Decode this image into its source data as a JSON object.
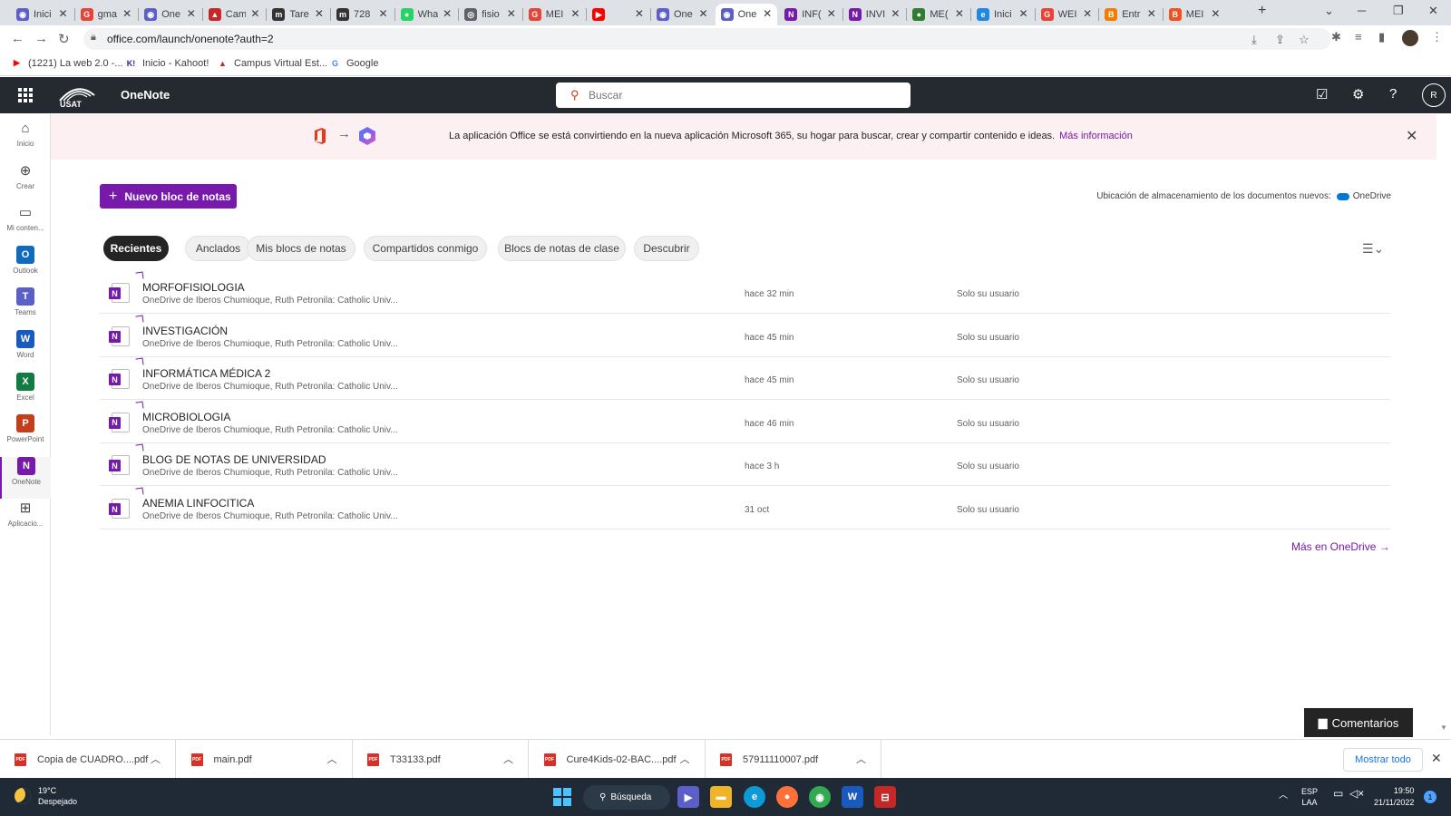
{
  "browser": {
    "tabs": [
      {
        "label": "Inici",
        "color": "#5b5fc7",
        "glyph": "◉"
      },
      {
        "label": "gma",
        "color": "#ea4335",
        "glyph": "G"
      },
      {
        "label": "One",
        "color": "#5b5fc7",
        "glyph": "◉"
      },
      {
        "label": "Cam",
        "color": "#c62828",
        "glyph": "▲"
      },
      {
        "label": "Tare",
        "color": "#333333",
        "glyph": "m"
      },
      {
        "label": "728",
        "color": "#333333",
        "glyph": "m"
      },
      {
        "label": "Wha",
        "color": "#25d366",
        "glyph": "●"
      },
      {
        "label": "fisio",
        "color": "#5f6368",
        "glyph": "◎"
      },
      {
        "label": "MEI",
        "color": "#ea4335",
        "glyph": "G"
      },
      {
        "label": "",
        "color": "#ff0000",
        "glyph": "▶"
      },
      {
        "label": "One",
        "color": "#5b5fc7",
        "glyph": "◉"
      },
      {
        "label": "One",
        "color": "#5b5fc7",
        "glyph": "◉"
      },
      {
        "label": "INF(",
        "color": "#7719aa",
        "glyph": "N"
      },
      {
        "label": "INVI",
        "color": "#7719aa",
        "glyph": "N"
      },
      {
        "label": "ME(",
        "color": "#2e7d32",
        "glyph": "●"
      },
      {
        "label": "Inici",
        "color": "#1e88e5",
        "glyph": "e"
      },
      {
        "label": "WEI",
        "color": "#ea4335",
        "glyph": "G"
      },
      {
        "label": "Entr",
        "color": "#f57c00",
        "glyph": "B"
      },
      {
        "label": "MEI",
        "color": "#f4511e",
        "glyph": "B"
      }
    ],
    "url": "office.com/launch/onenote?auth=2",
    "bookmarks": [
      {
        "label": "(1221) La web 2.0 -...",
        "color": "#ff0000",
        "glyph": "▶"
      },
      {
        "label": "Inicio - Kahoot!",
        "color": "#46178f",
        "glyph": "K!"
      },
      {
        "label": "Campus Virtual Est...",
        "color": "#c62828",
        "glyph": "▲"
      },
      {
        "label": "Google",
        "color": "#4285f4",
        "glyph": "G"
      }
    ]
  },
  "header": {
    "app_name": "OneNote",
    "search_placeholder": "Buscar",
    "user_initial": "R"
  },
  "rail": [
    {
      "label": "Inicio",
      "icon": "home-icon",
      "glyph": "⌂",
      "tile": false
    },
    {
      "label": "Crear",
      "icon": "create-icon",
      "glyph": "⊕",
      "tile": false
    },
    {
      "label": "Mi conten...",
      "icon": "folder-icon",
      "glyph": "▭",
      "tile": false
    },
    {
      "label": "Outlook",
      "icon": "outlook-icon",
      "glyph": "O",
      "tile": true,
      "color": "#0f6cbd"
    },
    {
      "label": "Teams",
      "icon": "teams-icon",
      "glyph": "T",
      "tile": true,
      "color": "#5b5fc7"
    },
    {
      "label": "Word",
      "icon": "word-icon",
      "glyph": "W",
      "tile": true,
      "color": "#185abd"
    },
    {
      "label": "Excel",
      "icon": "excel-icon",
      "glyph": "X",
      "tile": true,
      "color": "#107c41"
    },
    {
      "label": "PowerPoint",
      "icon": "powerpoint-icon",
      "glyph": "P",
      "tile": true,
      "color": "#c43e1c"
    },
    {
      "label": "OneNote",
      "icon": "onenote-icon",
      "glyph": "N",
      "tile": true,
      "color": "#7719aa",
      "active": true
    },
    {
      "label": "Aplicacio...",
      "icon": "apps-icon",
      "glyph": "⊞",
      "tile": false
    }
  ],
  "banner": {
    "text": "La aplicación Office se está convirtiendo en la nueva aplicación Microsoft 365, su hogar para buscar, crear y compartir contenido e ideas.",
    "link": "Más información"
  },
  "main": {
    "new_button": "Nuevo bloc de notas",
    "storage_label": "Ubicación de almacenamiento de los documentos nuevos:",
    "storage_value": "OneDrive",
    "filters": [
      {
        "label": "Recientes",
        "active": true
      },
      {
        "label": "Anclados"
      },
      {
        "label": "Mis blocs de notas"
      },
      {
        "label": "Compartidos conmigo"
      },
      {
        "label": "Blocs de notas de clase"
      },
      {
        "label": "Descubrir"
      }
    ],
    "notebooks": [
      {
        "title": "MORFOFISIOLOGIA",
        "path": "OneDrive de Iberos Chumioque, Ruth Petronila: Catholic Univ...",
        "time": "hace 32 min",
        "sharing": "Solo su usuario"
      },
      {
        "title": "INVESTIGACIÓN",
        "path": "OneDrive de Iberos Chumioque, Ruth Petronila: Catholic Univ...",
        "time": "hace 45 min",
        "sharing": "Solo su usuario"
      },
      {
        "title": "INFORMÁTICA MÉDICA 2",
        "path": "OneDrive de Iberos Chumioque, Ruth Petronila: Catholic Univ...",
        "time": "hace 45 min",
        "sharing": "Solo su usuario"
      },
      {
        "title": "MICROBIOLOGIA",
        "path": "OneDrive de Iberos Chumioque, Ruth Petronila: Catholic Univ...",
        "time": "hace 46 min",
        "sharing": "Solo su usuario"
      },
      {
        "title": "BLOG DE NOTAS DE UNIVERSIDAD",
        "path": "OneDrive de Iberos Chumioque, Ruth Petronila: Catholic Univ...",
        "time": "hace 3 h",
        "sharing": "Solo su usuario"
      },
      {
        "title": "ANEMIA LINFOCITICA",
        "path": "OneDrive de Iberos Chumioque, Ruth Petronila: Catholic Univ...",
        "time": "31 oct",
        "sharing": "Solo su usuario"
      }
    ],
    "more_link": "Más en OneDrive",
    "feedback": "Comentarios"
  },
  "downloads": {
    "items": [
      "Copia de CUADRO....pdf",
      "main.pdf",
      "T33133.pdf",
      "Cure4Kids-02-BAC....pdf",
      "57911110007.pdf"
    ],
    "pdf_badge": "PDF",
    "show_all": "Mostrar todo"
  },
  "taskbar": {
    "temp": "19°C",
    "weather": "Despejado",
    "search": "Búsqueda",
    "lang": "ESP",
    "layout": "LAA",
    "time": "19:50",
    "date": "21/11/2022",
    "notifications": "1"
  }
}
